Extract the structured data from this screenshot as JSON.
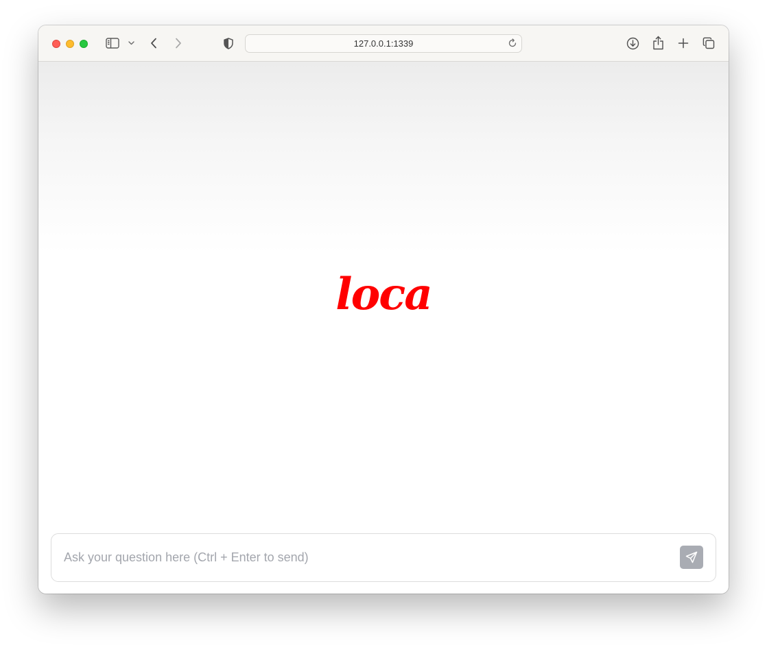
{
  "browser": {
    "url": "127.0.0.1:1339",
    "icons": {
      "sidebar": "sidebar-icon",
      "sidebar_menu": "chevron-down-icon",
      "back": "chevron-left-icon",
      "forward": "chevron-right-icon",
      "privacy": "shield-icon",
      "reload": "reload-icon",
      "downloads": "download-icon",
      "share": "share-icon",
      "new_tab": "plus-icon",
      "tabs_overview": "tabs-icon"
    }
  },
  "app": {
    "logo_text": "loca",
    "logo_color": "#ff0000",
    "input": {
      "value": "",
      "placeholder": "Ask your question here (Ctrl + Enter to send)"
    },
    "send_icon": "send-icon",
    "send_button_color": "#a9acb3"
  }
}
